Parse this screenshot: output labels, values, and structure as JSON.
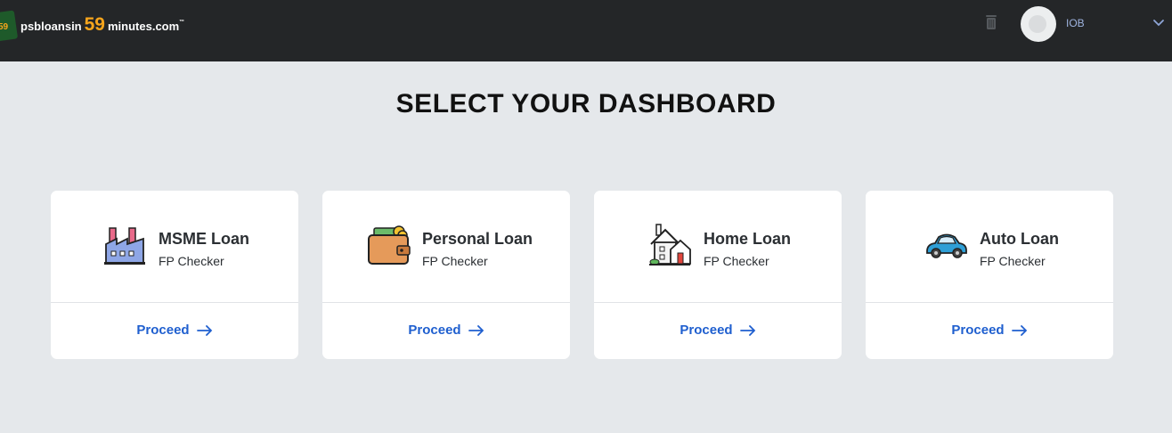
{
  "header": {
    "logo": {
      "part1": "psbloansin",
      "part2": "59",
      "part3": "minutes.com",
      "tm": "™",
      "badge": "59"
    },
    "user_name": "IOB"
  },
  "page_title": "SELECT YOUR DASHBOARD",
  "cards": [
    {
      "title": "MSME Loan",
      "subtitle": "FP Checker",
      "action": "Proceed",
      "icon": "factory-icon"
    },
    {
      "title": "Personal Loan",
      "subtitle": "FP Checker",
      "action": "Proceed",
      "icon": "wallet-icon"
    },
    {
      "title": "Home Loan",
      "subtitle": "FP Checker",
      "action": "Proceed",
      "icon": "house-icon"
    },
    {
      "title": "Auto Loan",
      "subtitle": "FP Checker",
      "action": "Proceed",
      "icon": "car-icon"
    }
  ],
  "colors": {
    "topbar": "#242628",
    "background": "#e5e8eb",
    "accent": "#1f5fcf",
    "logo_orange": "#f7a51c"
  }
}
